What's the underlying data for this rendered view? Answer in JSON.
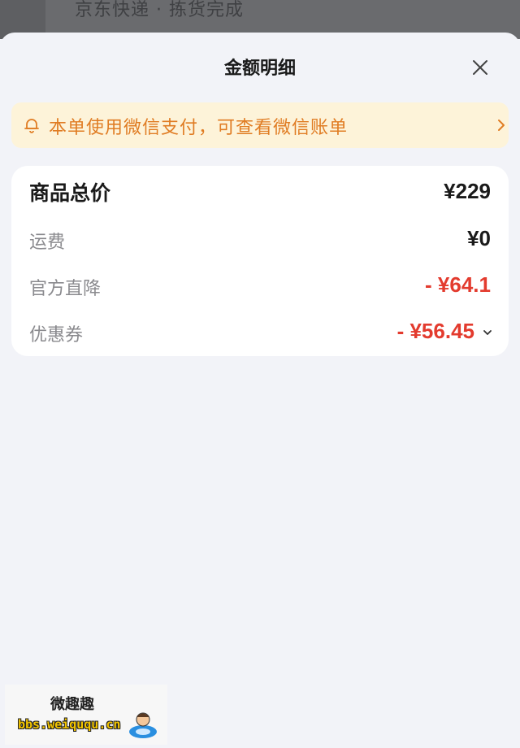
{
  "background": {
    "text": "京东快递 · 拣货完成"
  },
  "sheet": {
    "title": "金额明细",
    "close_icon": "close-icon"
  },
  "notice": {
    "icon": "bell-icon",
    "text": "本单使用微信支付，可查看微信账单",
    "chevron": "chevron-right-icon",
    "color": "#e07c23",
    "background": "#fdf3d9"
  },
  "price_rows": [
    {
      "label": "商品总价",
      "value": "¥229"
    },
    {
      "label": "运费",
      "value": "¥0"
    },
    {
      "label": "官方直降",
      "value": "- ¥64.1"
    },
    {
      "label": "优惠券",
      "value": "- ¥56.45"
    }
  ],
  "colors": {
    "discount_red": "#e33b2e",
    "text_primary": "#1a1a1a",
    "text_secondary": "#8a8a8e",
    "page_bg": "#f2f3f8"
  },
  "watermark": {
    "cn": "微趣趣",
    "url": "bbs.weiququ.cn"
  }
}
